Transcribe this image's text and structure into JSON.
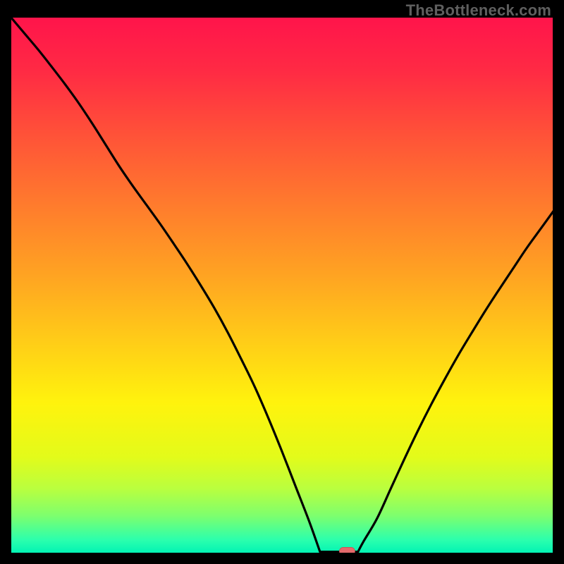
{
  "watermark": "TheBottleneck.com",
  "colors": {
    "gradient_stops": [
      {
        "offset": 0.0,
        "color": "#ff144b"
      },
      {
        "offset": 0.1,
        "color": "#ff2a44"
      },
      {
        "offset": 0.22,
        "color": "#ff5238"
      },
      {
        "offset": 0.35,
        "color": "#ff7b2d"
      },
      {
        "offset": 0.48,
        "color": "#ffa322"
      },
      {
        "offset": 0.6,
        "color": "#ffcb18"
      },
      {
        "offset": 0.72,
        "color": "#fff30d"
      },
      {
        "offset": 0.82,
        "color": "#e3fb1a"
      },
      {
        "offset": 0.88,
        "color": "#b9ff3f"
      },
      {
        "offset": 0.93,
        "color": "#7dff6e"
      },
      {
        "offset": 0.975,
        "color": "#2bffad"
      },
      {
        "offset": 1.0,
        "color": "#00f3b4"
      }
    ],
    "curve": "#000000",
    "marker_fill": "#e46a6c",
    "marker_stroke": "#c95254",
    "frame": "#000000"
  },
  "chart_data": {
    "type": "line",
    "title": "",
    "xlabel": "",
    "ylabel": "",
    "xlim": [
      0,
      100
    ],
    "ylim": [
      0,
      100
    ],
    "series": [
      {
        "name": "bottleneck-curve",
        "x": [
          0.0,
          2.5,
          5.0,
          7.5,
          10.0,
          12.5,
          15.0,
          17.5,
          20.0,
          22.5,
          25.0,
          27.5,
          30.0,
          32.5,
          35.0,
          37.5,
          40.0,
          42.5,
          45.0,
          47.5,
          50.0,
          52.5,
          55.0,
          57.5,
          60.0,
          62.5,
          65.0,
          67.5,
          70.0,
          72.5,
          75.0,
          77.5,
          80.0,
          82.5,
          85.0,
          87.5,
          90.0,
          92.5,
          95.0,
          97.5,
          100.0
        ],
        "y": [
          100.0,
          97.0,
          94.0,
          90.8,
          87.5,
          84.0,
          80.2,
          76.2,
          72.2,
          68.5,
          65.0,
          61.5,
          57.8,
          54.0,
          50.0,
          45.8,
          41.2,
          36.2,
          31.0,
          25.2,
          19.0,
          12.5,
          6.0,
          1.0,
          0.3,
          0.3,
          2.2,
          6.5,
          12.0,
          17.5,
          22.8,
          27.8,
          32.5,
          37.0,
          41.2,
          45.3,
          49.2,
          53.0,
          56.8,
          60.3,
          63.8
        ]
      }
    ],
    "marker": {
      "x": 62.0,
      "y": 0.4
    },
    "flat_bottom": {
      "x_start": 57.0,
      "x_end": 64.0,
      "y": 0.3
    }
  }
}
